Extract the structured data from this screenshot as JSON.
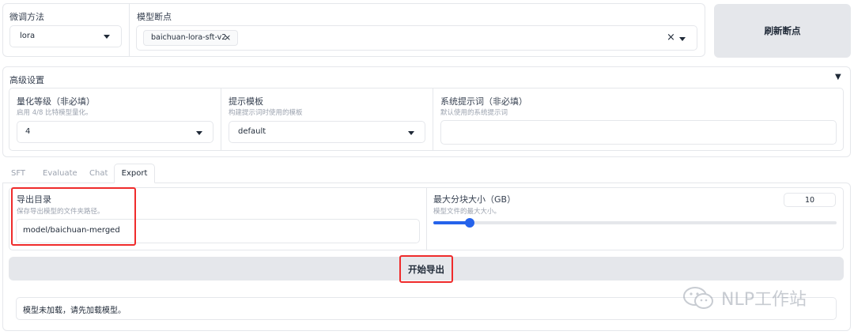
{
  "top": {
    "finetune_label": "微调方法",
    "finetune_value": "lora",
    "checkpoint_label": "模型断点",
    "checkpoint_chip": "baichuan-lora-sft-v2",
    "chip_close": "×",
    "clear_symbol": "×",
    "refresh_button": "刷新断点"
  },
  "advanced": {
    "title": "高级设置",
    "toggle": "▼",
    "quant_label": "量化等级（非必填）",
    "quant_hint": "启用 4/8 比特模型量化。",
    "quant_value": "4",
    "template_label": "提示模板",
    "template_hint": "构建提示词时使用的模板",
    "template_value": "default",
    "system_label": "系统提示词（非必填）",
    "system_hint": "默认使用的系统提示词",
    "system_value": ""
  },
  "tabs": [
    "SFT",
    "Evaluate",
    "Chat",
    "Export"
  ],
  "active_tab": "Export",
  "export": {
    "dir_label": "导出目录",
    "dir_hint": "保存导出模型的文件夹路径。",
    "dir_value": "model/baichuan-merged",
    "shard_label": "最大分块大小（GB）",
    "shard_hint": "模型文件的最大大小。",
    "shard_value": "10",
    "shard_min": 1,
    "shard_max": 100,
    "start_button": "开始导出"
  },
  "status": {
    "message": "模型未加载，请先加载模型。"
  },
  "watermark": "NLP工作站",
  "colors": {
    "accent": "#2563eb",
    "highlight": "#ef2b2b",
    "button_gray": "#e5e7eb"
  }
}
